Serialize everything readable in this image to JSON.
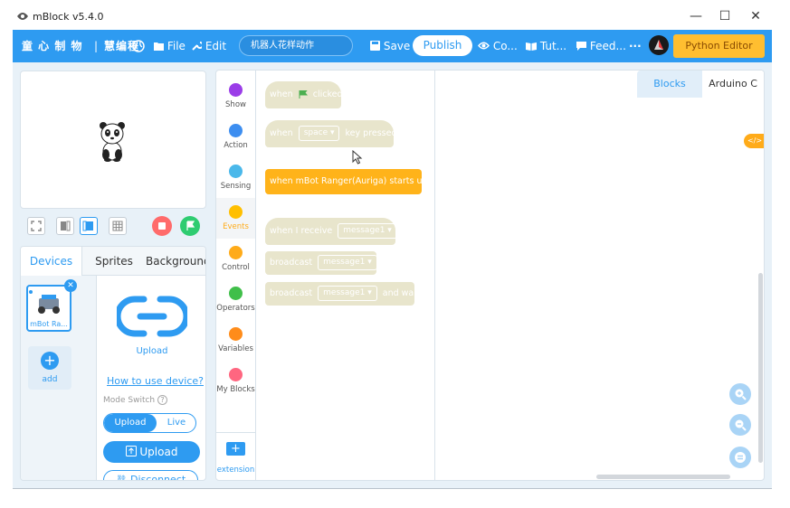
{
  "window": {
    "title": "mBlock v5.4.0",
    "minimize_glyph": "—",
    "maximize_glyph": "☐",
    "close_glyph": "✕"
  },
  "menubar": {
    "brand": "童 心 制 物",
    "separator": "|",
    "product": "慧编程",
    "globe_icon": "globe-icon",
    "file_label": "File",
    "edit_label": "Edit",
    "project_name": "机器人花样动作",
    "save_label": "Save",
    "publish_label": "Publish",
    "community_label": "Co...",
    "tutorials_label": "Tut...",
    "feedback_label": "Feed...",
    "more_label": "···",
    "python_editor_label": "Python Editor"
  },
  "stage_tools": {
    "stop_color": "#ff6b6b",
    "go_color": "#2ecc71"
  },
  "device_panel": {
    "tabs": [
      "Devices",
      "Sprites",
      "Background"
    ],
    "active_tab": "Devices",
    "device_name": "mBot Ra...",
    "add_label": "add",
    "upload_caption": "Upload",
    "how_to_link": "How to use device?",
    "mode_switch_label": "Mode Switch",
    "mode_help": "?",
    "mode_upload": "Upload",
    "mode_live": "Live",
    "upload_button": "Upload",
    "disconnect_button": "Disconnect"
  },
  "categories": [
    {
      "label": "Show",
      "color": "#9b3de8"
    },
    {
      "label": "Action",
      "color": "#3d8ef0"
    },
    {
      "label": "Sensing",
      "color": "#4ab8ea"
    },
    {
      "label": "Events",
      "color": "#ffbf00"
    },
    {
      "label": "Control",
      "color": "#ffab19"
    },
    {
      "label": "Operators",
      "color": "#40bf4a"
    },
    {
      "label": "Variables",
      "color": "#ff8c1a"
    },
    {
      "label": "My Blocks",
      "color": "#ff6680"
    }
  ],
  "active_category": "Events",
  "extension_label": "extension",
  "blocks": {
    "when_flag_prefix": "when",
    "when_flag_suffix": "clicked",
    "when_key_prefix": "when",
    "when_key_value": "space ▾",
    "when_key_suffix": "key pressed",
    "starts_up": "when mBot Ranger(Auriga) starts up",
    "receive_prefix": "when I receive",
    "receive_value": "message1 ▾",
    "broadcast_prefix": "broadcast",
    "broadcast_value": "message1 ▾",
    "broadcast_wait_prefix": "broadcast",
    "broadcast_wait_value": "message1 ▾",
    "broadcast_wait_suffix": "and wait"
  },
  "code_tabs": {
    "blocks": "Blocks",
    "arduino": "Arduino C"
  },
  "code_toggle": "</>",
  "zoom": {
    "zoom_in": "zoom-in-icon",
    "zoom_out": "zoom-out-icon",
    "reset": "reset-zoom-icon"
  }
}
